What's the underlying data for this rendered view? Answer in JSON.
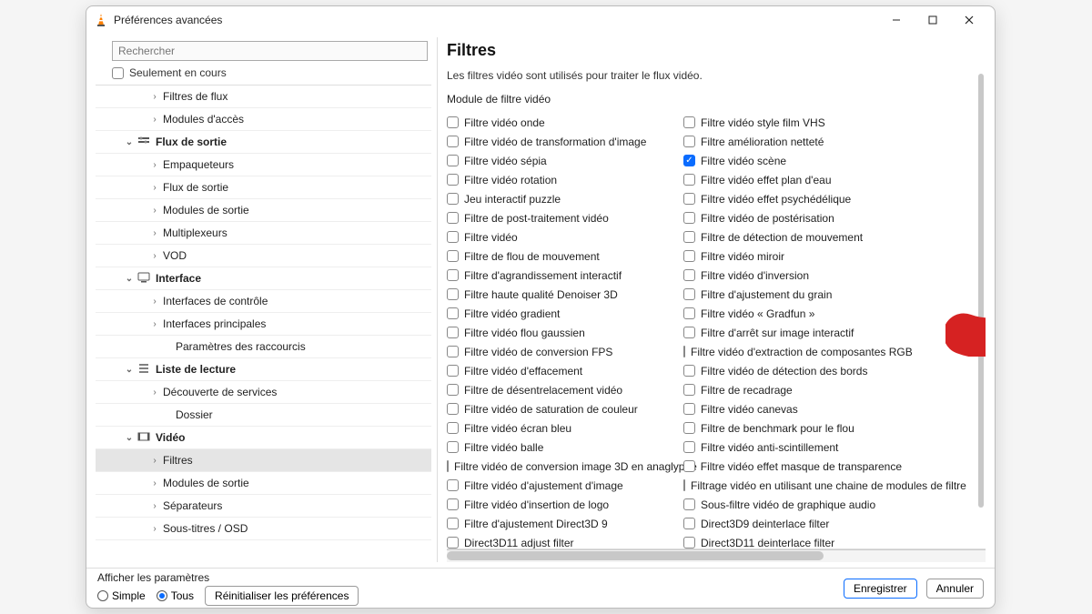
{
  "window": {
    "title": "Préférences avancées",
    "minimize_tooltip": "Réduire",
    "maximize_tooltip": "Agrandir",
    "close_tooltip": "Fermer"
  },
  "left": {
    "search_placeholder": "Rechercher",
    "only_current": "Seulement en cours",
    "tree": [
      {
        "indent": 56,
        "arrow": "›",
        "label": "Filtres de flux",
        "group": false
      },
      {
        "indent": 56,
        "arrow": "›",
        "label": "Modules d'accès",
        "group": false
      },
      {
        "indent": 28,
        "arrow": "⌄",
        "label": "Flux de sortie",
        "group": true,
        "icon": "flux-icon"
      },
      {
        "indent": 56,
        "arrow": "›",
        "label": "Empaqueteurs",
        "group": false
      },
      {
        "indent": 56,
        "arrow": "›",
        "label": "Flux de sortie",
        "group": false
      },
      {
        "indent": 56,
        "arrow": "›",
        "label": "Modules de sortie",
        "group": false
      },
      {
        "indent": 56,
        "arrow": "›",
        "label": "Multiplexeurs",
        "group": false
      },
      {
        "indent": 56,
        "arrow": "›",
        "label": "VOD",
        "group": false
      },
      {
        "indent": 28,
        "arrow": "⌄",
        "label": "Interface",
        "group": true,
        "icon": "interface-icon"
      },
      {
        "indent": 56,
        "arrow": "›",
        "label": "Interfaces de contrôle",
        "group": false
      },
      {
        "indent": 56,
        "arrow": "›",
        "label": "Interfaces principales",
        "group": false
      },
      {
        "indent": 70,
        "arrow": "",
        "label": "Paramètres des raccourcis",
        "group": false
      },
      {
        "indent": 28,
        "arrow": "⌄",
        "label": "Liste de lecture",
        "group": true,
        "icon": "playlist-icon"
      },
      {
        "indent": 56,
        "arrow": "›",
        "label": "Découverte de services",
        "group": false
      },
      {
        "indent": 70,
        "arrow": "",
        "label": "Dossier",
        "group": false
      },
      {
        "indent": 28,
        "arrow": "⌄",
        "label": "Vidéo",
        "group": true,
        "icon": "video-icon"
      },
      {
        "indent": 56,
        "arrow": "›",
        "label": "Filtres",
        "group": false,
        "selected": true
      },
      {
        "indent": 56,
        "arrow": "›",
        "label": "Modules de sortie",
        "group": false
      },
      {
        "indent": 56,
        "arrow": "›",
        "label": "Séparateurs",
        "group": false
      },
      {
        "indent": 56,
        "arrow": "›",
        "label": "Sous-titres / OSD",
        "group": false
      }
    ]
  },
  "right": {
    "heading": "Filtres",
    "description": "Les filtres vidéo sont utilisés pour traiter le flux vidéo.",
    "subheading": "Module de filtre vidéo",
    "filters_left": [
      {
        "label": "Filtre vidéo onde",
        "checked": false
      },
      {
        "label": "Filtre vidéo de transformation d'image",
        "checked": false
      },
      {
        "label": "Filtre vidéo sépia",
        "checked": false
      },
      {
        "label": "Filtre vidéo rotation",
        "checked": false
      },
      {
        "label": "Jeu interactif puzzle",
        "checked": false
      },
      {
        "label": "Filtre de post-traitement vidéo",
        "checked": false
      },
      {
        "label": "Filtre vidéo",
        "checked": false
      },
      {
        "label": "Filtre de flou de mouvement",
        "checked": false
      },
      {
        "label": "Filtre d'agrandissement interactif",
        "checked": false
      },
      {
        "label": "Filtre haute qualité Denoiser 3D",
        "checked": false
      },
      {
        "label": "Filtre vidéo gradient",
        "checked": false
      },
      {
        "label": "Filtre vidéo flou gaussien",
        "checked": false
      },
      {
        "label": "Filtre vidéo de conversion FPS",
        "checked": false
      },
      {
        "label": "Filtre vidéo d'effacement",
        "checked": false
      },
      {
        "label": "Filtre de désentrelacement vidéo",
        "checked": false
      },
      {
        "label": "Filtre vidéo de saturation de couleur",
        "checked": false
      },
      {
        "label": "Filtre vidéo écran bleu",
        "checked": false
      },
      {
        "label": "Filtre vidéo balle",
        "checked": false
      },
      {
        "label": "Filtre vidéo de conversion image 3D en anaglyphe",
        "checked": false
      },
      {
        "label": "Filtre vidéo d'ajustement d'image",
        "checked": false
      },
      {
        "label": "Filtre vidéo d'insertion de logo",
        "checked": false
      },
      {
        "label": "Filtre d'ajustement Direct3D 9",
        "checked": false
      },
      {
        "label": "Direct3D11 adjust filter",
        "checked": false
      }
    ],
    "filters_right": [
      {
        "label": "Filtre vidéo style film VHS",
        "checked": false
      },
      {
        "label": "Filtre amélioration netteté",
        "checked": false
      },
      {
        "label": "Filtre vidéo scène",
        "checked": true
      },
      {
        "label": "Filtre vidéo effet plan d'eau",
        "checked": false
      },
      {
        "label": "Filtre vidéo effet psychédélique",
        "checked": false
      },
      {
        "label": "Filtre vidéo de postérisation",
        "checked": false
      },
      {
        "label": "Filtre de détection de mouvement",
        "checked": false
      },
      {
        "label": "Filtre vidéo miroir",
        "checked": false
      },
      {
        "label": "Filtre vidéo d'inversion",
        "checked": false
      },
      {
        "label": "Filtre d'ajustement du grain",
        "checked": false
      },
      {
        "label": "Filtre vidéo « Gradfun »",
        "checked": false
      },
      {
        "label": "Filtre d'arrêt sur image interactif",
        "checked": false
      },
      {
        "label": "Filtre vidéo d'extraction de composantes RGB",
        "checked": false
      },
      {
        "label": "Filtre vidéo de détection des bords",
        "checked": false
      },
      {
        "label": "Filtre de recadrage",
        "checked": false
      },
      {
        "label": "Filtre vidéo canevas",
        "checked": false
      },
      {
        "label": "Filtre de benchmark pour le flou",
        "checked": false
      },
      {
        "label": "Filtre vidéo anti-scintillement",
        "checked": false
      },
      {
        "label": "Filtre vidéo effet masque de transparence",
        "checked": false
      },
      {
        "label": "Filtrage vidéo en utilisant une chaine de modules de filtre",
        "checked": false
      },
      {
        "label": "Sous-filtre vidéo de graphique audio",
        "checked": false
      },
      {
        "label": "Direct3D9 deinterlace filter",
        "checked": false
      },
      {
        "label": "Direct3D11 deinterlace filter",
        "checked": false
      }
    ]
  },
  "footer": {
    "show_params": "Afficher les paramètres",
    "simple": "Simple",
    "all": "Tous",
    "reset": "Réinitialiser les préférences",
    "save": "Enregistrer",
    "cancel": "Annuler"
  }
}
